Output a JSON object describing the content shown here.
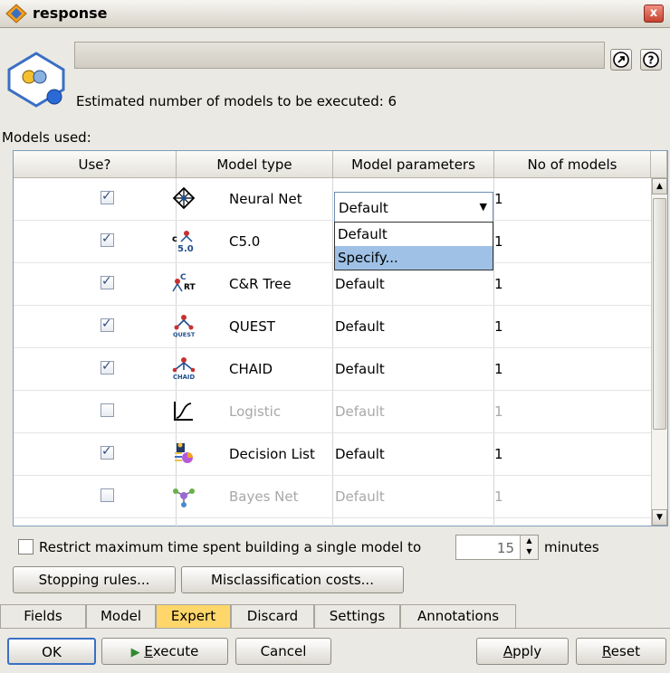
{
  "window": {
    "title": "response",
    "close_label": "x"
  },
  "header": {
    "estimate_text": "Estimated number of models to be executed: 6",
    "models_used_label": "Models used:"
  },
  "table": {
    "columns": [
      "Use?",
      "Model type",
      "Model parameters",
      "No of models"
    ],
    "rows": [
      {
        "checked": true,
        "icon": "neural-net-icon",
        "type": "Neural Net",
        "params": "Default",
        "count": "1",
        "enabled": true
      },
      {
        "checked": true,
        "icon": "c50-icon",
        "type": "C5.0",
        "params": "",
        "count": "1",
        "enabled": true
      },
      {
        "checked": true,
        "icon": "cart-tree-icon",
        "type": "C&R Tree",
        "params": "Default",
        "count": "1",
        "enabled": true
      },
      {
        "checked": true,
        "icon": "quest-icon",
        "type": "QUEST",
        "params": "Default",
        "count": "1",
        "enabled": true
      },
      {
        "checked": true,
        "icon": "chaid-icon",
        "type": "CHAID",
        "params": "Default",
        "count": "1",
        "enabled": true
      },
      {
        "checked": false,
        "icon": "logistic-icon",
        "type": "Logistic",
        "params": "Default",
        "count": "1",
        "enabled": false
      },
      {
        "checked": true,
        "icon": "decision-list-icon",
        "type": "Decision List",
        "params": "Default",
        "count": "1",
        "enabled": true
      },
      {
        "checked": false,
        "icon": "bayes-net-icon",
        "type": "Bayes Net",
        "params": "Default",
        "count": "1",
        "enabled": false
      }
    ],
    "combo_value": "Default",
    "dropdown_options": [
      "Default",
      "Specify..."
    ],
    "dropdown_selected": "Specify..."
  },
  "restrict": {
    "label": "Restrict maximum time spent building a single model to",
    "value": "15",
    "unit": "minutes",
    "checked": false
  },
  "buttons": {
    "stopping_rules": "Stopping rules...",
    "misclassification_costs": "Misclassification costs...",
    "ok": "OK",
    "execute_pre": "",
    "execute_u": "E",
    "execute_post": "xecute",
    "cancel": "Cancel",
    "apply_u": "A",
    "apply_post": "pply",
    "reset_u": "R",
    "reset_post": "eset"
  },
  "tabs": [
    {
      "label": "Fields",
      "active": false
    },
    {
      "label": "Model",
      "active": false
    },
    {
      "label": "Expert",
      "active": true
    },
    {
      "label": "Discard",
      "active": false
    },
    {
      "label": "Settings",
      "active": false
    },
    {
      "label": "Annotations",
      "active": false
    }
  ],
  "colors": {
    "active_tab": "#ffd66a",
    "selection": "#9fc1e6",
    "accent": "#1f4e8c"
  }
}
